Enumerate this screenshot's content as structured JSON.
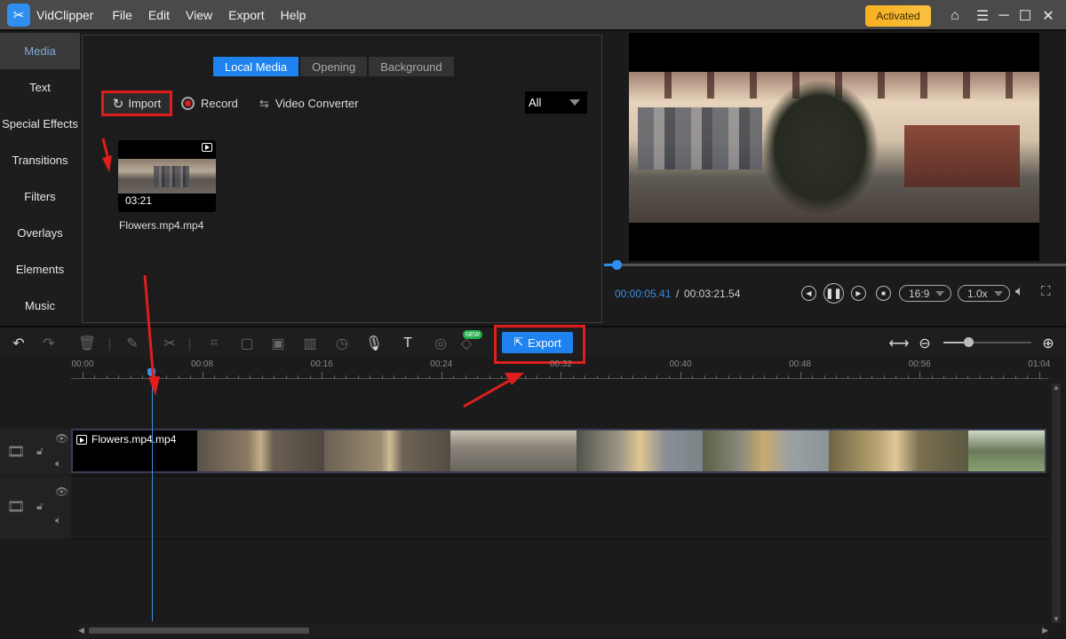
{
  "app": {
    "name": "VidClipper",
    "menu": [
      "File",
      "Edit",
      "View",
      "Export",
      "Help"
    ],
    "activated_label": "Activated",
    "window_icons": [
      "home-icon",
      "menu-icon",
      "minimize-icon",
      "maximize-icon",
      "close-icon"
    ]
  },
  "sidebar": {
    "items": [
      {
        "label": "Media",
        "active": true
      },
      {
        "label": "Text"
      },
      {
        "label": "Special Effects"
      },
      {
        "label": "Transitions"
      },
      {
        "label": "Filters"
      },
      {
        "label": "Overlays"
      },
      {
        "label": "Elements"
      },
      {
        "label": "Music"
      }
    ]
  },
  "media": {
    "tabs": [
      {
        "label": "Local Media",
        "active": true
      },
      {
        "label": "Opening"
      },
      {
        "label": "Background"
      }
    ],
    "import_label": "Import",
    "record_label": "Record",
    "converter_label": "Video Converter",
    "filter_value": "All",
    "items": [
      {
        "name": "Flowers.mp4.mp4",
        "duration": "03:21"
      }
    ]
  },
  "preview": {
    "current_time": "00:00:05.41",
    "separator": "/",
    "total_time": "00:03:21.54",
    "progress_fraction": 0.027,
    "aspect_ratio": "16:9",
    "speed": "1.0x",
    "controls": [
      "prev-frame-icon",
      "pause-icon",
      "next-frame-icon",
      "stop-icon",
      "volume-icon",
      "fullscreen-icon"
    ]
  },
  "timeline": {
    "export_label": "Export",
    "new_badge": "NEW",
    "zoom_fraction": 0.28,
    "ruler_labels": [
      "00:00",
      "00:08",
      "00:16",
      "00:24",
      "00:32",
      "00:40",
      "00:48",
      "00:56",
      "01:04"
    ],
    "playhead_time": "00:05",
    "tracks": [
      {
        "clip": "Flowers.mp4.mp4"
      },
      {
        "clip": ""
      }
    ]
  },
  "colors": {
    "accent": "#1e82ef",
    "highlight": "#e01e1e",
    "activated": "#f7b020"
  }
}
